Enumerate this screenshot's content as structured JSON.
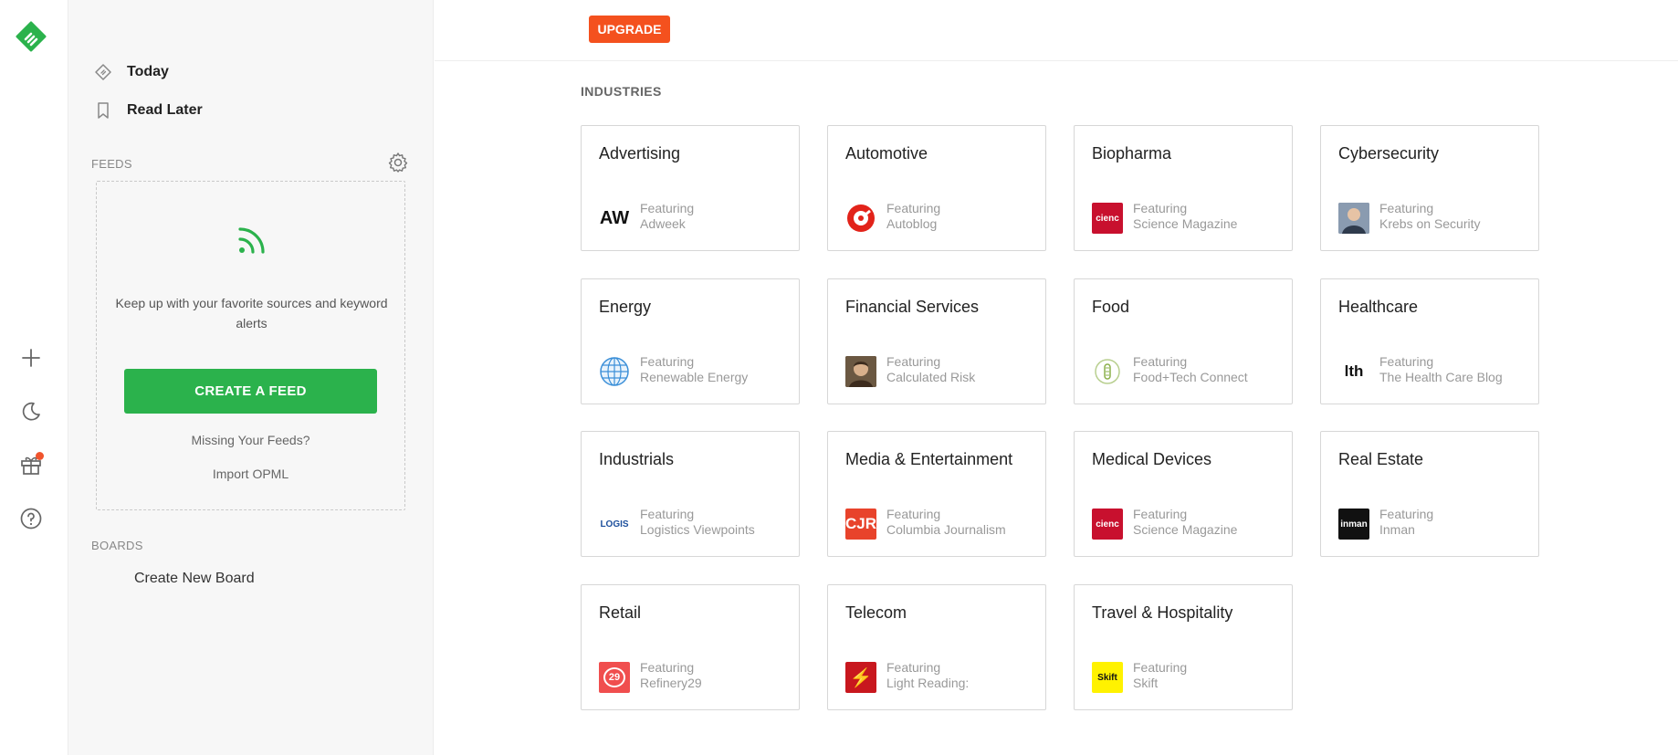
{
  "colors": {
    "brand_green": "#2bb24c",
    "upgrade_orange": "#f4511e",
    "badge_red": "#f0542d"
  },
  "rail": {
    "icons": [
      "feedly-logo-icon",
      "add-icon",
      "moon-icon",
      "gift-icon",
      "help-icon"
    ]
  },
  "sidebar": {
    "nav": [
      {
        "label": "Today",
        "icon": "today-icon"
      },
      {
        "label": "Read Later",
        "icon": "bookmark-icon"
      }
    ],
    "feeds_label": "FEEDS",
    "feed_box": {
      "description": "Keep up with your favorite sources and keyword alerts",
      "create_button": "CREATE A FEED",
      "missing_link": "Missing Your Feeds?",
      "import_link": "Import OPML"
    },
    "boards_label": "BOARDS",
    "create_board": "Create New Board"
  },
  "main": {
    "upgrade_label": "UPGRADE",
    "industries_label": "INDUSTRIES",
    "featuring_label": "Featuring",
    "cards": [
      {
        "title": "Advertising",
        "source": "Adweek",
        "logo_text": "AW",
        "logo_bg": "#ffffff",
        "logo_color": "#111111"
      },
      {
        "title": "Automotive",
        "source": "Autoblog",
        "logo_text": "",
        "logo_bg": "#ffffff",
        "logo_color": "#e2231a"
      },
      {
        "title": "Biopharma",
        "source": "Science Magazine",
        "logo_text": "cienc",
        "logo_bg": "#c8102e",
        "logo_color": "#ffffff"
      },
      {
        "title": "Cybersecurity",
        "source": "Krebs on Security",
        "logo_text": "",
        "logo_bg": "#6b7a8f",
        "logo_color": "#ffffff"
      },
      {
        "title": "Energy",
        "source": "Renewable Energy",
        "logo_text": "",
        "logo_bg": "#ffffff",
        "logo_color": "#3b8fd8"
      },
      {
        "title": "Financial Services",
        "source": "Calculated Risk",
        "logo_text": "",
        "logo_bg": "#5a4a38",
        "logo_color": "#ffffff"
      },
      {
        "title": "Food",
        "source": "Food+Tech Connect",
        "logo_text": "",
        "logo_bg": "#ffffff",
        "logo_color": "#8bb04a"
      },
      {
        "title": "Healthcare",
        "source": "The Health Care Blog",
        "logo_text": "lth",
        "logo_bg": "#ffffff",
        "logo_color": "#111111"
      },
      {
        "title": "Industrials",
        "source": "Logistics Viewpoints",
        "logo_text": "LOGIS",
        "logo_bg": "#ffffff",
        "logo_color": "#1c4f9c"
      },
      {
        "title": "Media & Entertainment",
        "source": "Columbia Journalism",
        "logo_text": "CJR",
        "logo_bg": "#e8432b",
        "logo_color": "#ffffff"
      },
      {
        "title": "Medical Devices",
        "source": "Science Magazine",
        "logo_text": "cienc",
        "logo_bg": "#c8102e",
        "logo_color": "#ffffff"
      },
      {
        "title": "Real Estate",
        "source": "Inman",
        "logo_text": "inman",
        "logo_bg": "#111111",
        "logo_color": "#ffffff"
      },
      {
        "title": "Retail",
        "source": "Refinery29",
        "logo_text": "29",
        "logo_bg": "#f04e4e",
        "logo_color": "#ffffff"
      },
      {
        "title": "Telecom",
        "source": "Light Reading:",
        "logo_text": "⚡",
        "logo_bg": "#c8171e",
        "logo_color": "#ffffff"
      },
      {
        "title": "Travel & Hospitality",
        "source": "Skift",
        "logo_text": "Skift",
        "logo_bg": "#fff200",
        "logo_color": "#111111"
      }
    ]
  }
}
